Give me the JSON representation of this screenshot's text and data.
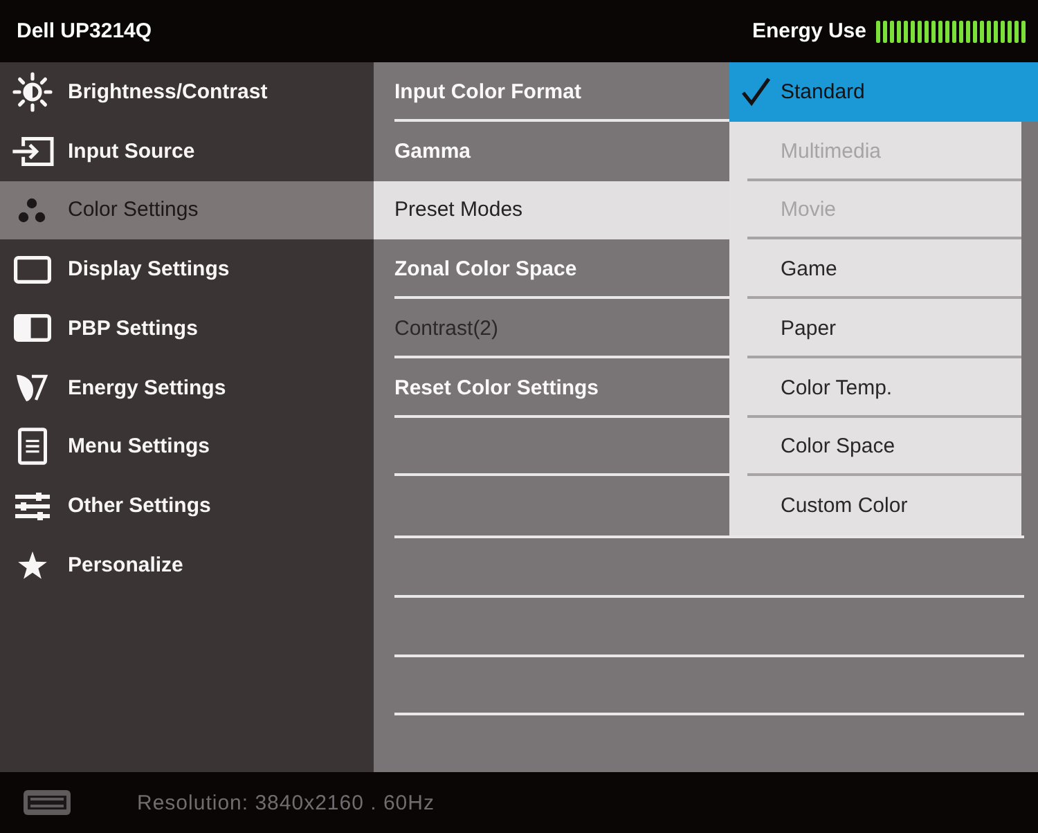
{
  "header": {
    "title": "Dell UP3214Q",
    "energy_label": "Energy Use",
    "energy_meter": {
      "level": 1
    }
  },
  "sidebar": {
    "items": [
      {
        "label": "Brightness/Contrast",
        "selected": false
      },
      {
        "label": "Input Source",
        "selected": false
      },
      {
        "label": "Color Settings",
        "selected": true
      },
      {
        "label": "Display Settings",
        "selected": false
      },
      {
        "label": "PBP Settings",
        "selected": false
      },
      {
        "label": "Energy Settings",
        "selected": false
      },
      {
        "label": "Menu Settings",
        "selected": false
      },
      {
        "label": "Other Settings",
        "selected": false
      },
      {
        "label": "Personalize",
        "selected": false
      }
    ]
  },
  "submenu": {
    "items": [
      {
        "label": "Input Color Format",
        "selected": false,
        "disabled": false
      },
      {
        "label": "Gamma",
        "selected": false,
        "disabled": false
      },
      {
        "label": "Preset Modes",
        "selected": true,
        "disabled": false
      },
      {
        "label": "Zonal Color Space",
        "selected": false,
        "disabled": false
      },
      {
        "label": "Contrast(2)",
        "selected": false,
        "disabled": true
      },
      {
        "label": "Reset Color Settings",
        "selected": false,
        "disabled": false
      }
    ]
  },
  "options": {
    "items": [
      {
        "label": "Standard",
        "selected": true,
        "disabled": false
      },
      {
        "label": "Multimedia",
        "selected": false,
        "disabled": true
      },
      {
        "label": "Movie",
        "selected": false,
        "disabled": true
      },
      {
        "label": "Game",
        "selected": false,
        "disabled": false
      },
      {
        "label": "Paper",
        "selected": false,
        "disabled": false
      },
      {
        "label": "Color Temp.",
        "selected": false,
        "disabled": false
      },
      {
        "label": "Color Space",
        "selected": false,
        "disabled": false
      },
      {
        "label": "Custom Color",
        "selected": false,
        "disabled": false
      }
    ]
  },
  "status_bar": {
    "resolution": "Resolution: 3840x2160 . 60Hz"
  }
}
